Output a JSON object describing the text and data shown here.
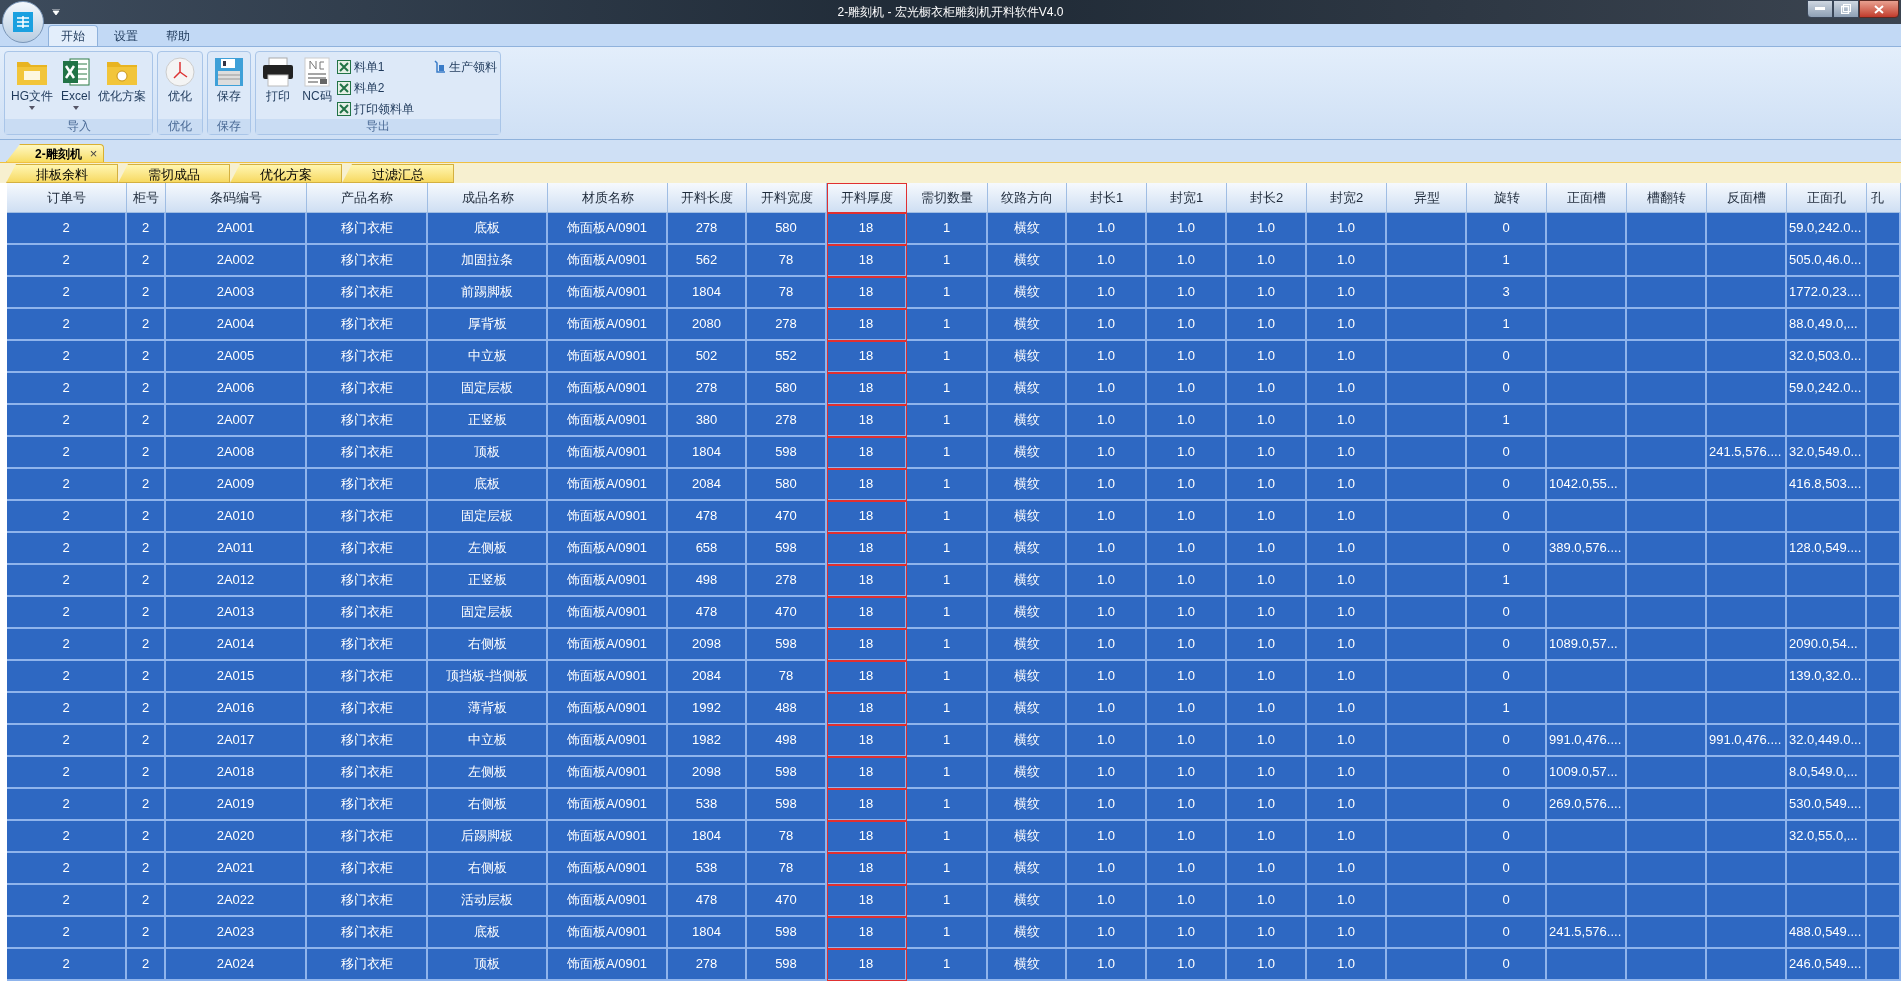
{
  "window": {
    "title": "2-雕刻机 - 宏光橱衣柜雕刻机开料软件V4.0"
  },
  "ribbon_tabs": [
    {
      "label": "开始",
      "selected": true
    },
    {
      "label": "设置",
      "selected": false
    },
    {
      "label": "帮助",
      "selected": false
    }
  ],
  "ribbon_groups": [
    {
      "label": "导入",
      "buttons": [
        {
          "label": "HG文件",
          "dropdown": true
        },
        {
          "label": "Excel",
          "dropdown": true
        },
        {
          "label": "优化方案",
          "dropdown": false
        }
      ]
    },
    {
      "label": "优化",
      "buttons": [
        {
          "label": "优化",
          "dropdown": false
        }
      ]
    },
    {
      "label": "保存",
      "buttons": [
        {
          "label": "保存",
          "dropdown": false
        }
      ]
    },
    {
      "label": "导出",
      "buttons": [
        {
          "label": "打印",
          "dropdown": false
        },
        {
          "label": "NC码",
          "dropdown": false
        }
      ],
      "small_buttons": [
        "料单1",
        "料单2",
        "打印领料单",
        "生产领料"
      ]
    }
  ],
  "document_tab": {
    "label": "2-雕刻机",
    "close": "×"
  },
  "sub_tabs": [
    "排板余料",
    "需切成品",
    "优化方案",
    "过滤汇总"
  ],
  "table": {
    "columns": [
      {
        "label": "订单号",
        "selected": false
      },
      {
        "label": "柜号",
        "selected": false
      },
      {
        "label": "条码编号",
        "selected": false
      },
      {
        "label": "产品名称",
        "selected": false
      },
      {
        "label": "成品名称",
        "selected": false
      },
      {
        "label": "材质名称",
        "selected": false
      },
      {
        "label": "开料长度",
        "selected": false
      },
      {
        "label": "开料宽度",
        "selected": false
      },
      {
        "label": "开料厚度",
        "selected": true
      },
      {
        "label": "需切数量",
        "selected": false
      },
      {
        "label": "纹路方向",
        "selected": false
      },
      {
        "label": "封长1",
        "selected": false
      },
      {
        "label": "封宽1",
        "selected": false
      },
      {
        "label": "封长2",
        "selected": false
      },
      {
        "label": "封宽2",
        "selected": false
      },
      {
        "label": "异型",
        "selected": false
      },
      {
        "label": "旋转",
        "selected": false
      },
      {
        "label": "正面槽",
        "selected": false
      },
      {
        "label": "槽翻转",
        "selected": false
      },
      {
        "label": "反面槽",
        "selected": false
      },
      {
        "label": "正面孔",
        "selected": false
      },
      {
        "label": "孔",
        "selected": false
      }
    ],
    "rows": [
      {
        "selected": true,
        "cells": [
          "2",
          "2",
          "2A001",
          "移门衣柜",
          "底板",
          "饰面板A/0901",
          "278",
          "580",
          "18",
          "1",
          "横纹",
          "1.0",
          "1.0",
          "1.0",
          "1.0",
          null,
          "0",
          null,
          null,
          null,
          "59.0,242.0...",
          null
        ]
      },
      {
        "selected": true,
        "cells": [
          "2",
          "2",
          "2A002",
          "移门衣柜",
          "加固拉条",
          "饰面板A/0901",
          "562",
          "78",
          "18",
          "1",
          "横纹",
          "1.0",
          "1.0",
          "1.0",
          "1.0",
          null,
          "1",
          null,
          null,
          null,
          "505.0,46.0...",
          null
        ]
      },
      {
        "selected": true,
        "cells": [
          "2",
          "2",
          "2A003",
          "移门衣柜",
          "前踢脚板",
          "饰面板A/0901",
          "1804",
          "78",
          "18",
          "1",
          "横纹",
          "1.0",
          "1.0",
          "1.0",
          "1.0",
          null,
          "3",
          null,
          null,
          null,
          "1772.0,23....",
          null
        ]
      },
      {
        "selected": true,
        "cells": [
          "2",
          "2",
          "2A004",
          "移门衣柜",
          "厚背板",
          "饰面板A/0901",
          "2080",
          "278",
          "18",
          "1",
          "横纹",
          "1.0",
          "1.0",
          "1.0",
          "1.0",
          null,
          "1",
          null,
          null,
          null,
          "88.0,49.0,...",
          null
        ]
      },
      {
        "selected": true,
        "cells": [
          "2",
          "2",
          "2A005",
          "移门衣柜",
          "中立板",
          "饰面板A/0901",
          "502",
          "552",
          "18",
          "1",
          "横纹",
          "1.0",
          "1.0",
          "1.0",
          "1.0",
          null,
          "0",
          null,
          null,
          null,
          "32.0,503.0...",
          null
        ]
      },
      {
        "selected": true,
        "cells": [
          "2",
          "2",
          "2A006",
          "移门衣柜",
          "固定层板",
          "饰面板A/0901",
          "278",
          "580",
          "18",
          "1",
          "横纹",
          "1.0",
          "1.0",
          "1.0",
          "1.0",
          null,
          "0",
          null,
          null,
          null,
          "59.0,242.0...",
          null
        ]
      },
      {
        "selected": true,
        "cells": [
          "2",
          "2",
          "2A007",
          "移门衣柜",
          "正竖板",
          "饰面板A/0901",
          "380",
          "278",
          "18",
          "1",
          "横纹",
          "1.0",
          "1.0",
          "1.0",
          "1.0",
          null,
          "1",
          null,
          null,
          null,
          null,
          null
        ]
      },
      {
        "selected": true,
        "cells": [
          "2",
          "2",
          "2A008",
          "移门衣柜",
          "顶板",
          "饰面板A/0901",
          "1804",
          "598",
          "18",
          "1",
          "横纹",
          "1.0",
          "1.0",
          "1.0",
          "1.0",
          null,
          "0",
          null,
          null,
          "241.5,576....",
          "32.0,549.0...",
          null
        ]
      },
      {
        "selected": true,
        "cells": [
          "2",
          "2",
          "2A009",
          "移门衣柜",
          "底板",
          "饰面板A/0901",
          "2084",
          "580",
          "18",
          "1",
          "横纹",
          "1.0",
          "1.0",
          "1.0",
          "1.0",
          null,
          "0",
          "1042.0,55...",
          null,
          null,
          "416.8,503....",
          null
        ]
      },
      {
        "selected": true,
        "cells": [
          "2",
          "2",
          "2A010",
          "移门衣柜",
          "固定层板",
          "饰面板A/0901",
          "478",
          "470",
          "18",
          "1",
          "横纹",
          "1.0",
          "1.0",
          "1.0",
          "1.0",
          null,
          "0",
          null,
          null,
          null,
          null,
          null
        ]
      },
      {
        "selected": true,
        "cells": [
          "2",
          "2",
          "2A011",
          "移门衣柜",
          "左侧板",
          "饰面板A/0901",
          "658",
          "598",
          "18",
          "1",
          "横纹",
          "1.0",
          "1.0",
          "1.0",
          "1.0",
          null,
          "0",
          "389.0,576....",
          null,
          null,
          "128.0,549....",
          null
        ]
      },
      {
        "selected": true,
        "cells": [
          "2",
          "2",
          "2A012",
          "移门衣柜",
          "正竖板",
          "饰面板A/0901",
          "498",
          "278",
          "18",
          "1",
          "横纹",
          "1.0",
          "1.0",
          "1.0",
          "1.0",
          null,
          "1",
          null,
          null,
          null,
          null,
          null
        ]
      },
      {
        "selected": true,
        "cells": [
          "2",
          "2",
          "2A013",
          "移门衣柜",
          "固定层板",
          "饰面板A/0901",
          "478",
          "470",
          "18",
          "1",
          "横纹",
          "1.0",
          "1.0",
          "1.0",
          "1.0",
          null,
          "0",
          null,
          null,
          null,
          null,
          null
        ]
      },
      {
        "selected": true,
        "cells": [
          "2",
          "2",
          "2A014",
          "移门衣柜",
          "右侧板",
          "饰面板A/0901",
          "2098",
          "598",
          "18",
          "1",
          "横纹",
          "1.0",
          "1.0",
          "1.0",
          "1.0",
          null,
          "0",
          "1089.0,57...",
          null,
          null,
          "2090.0,54...",
          null
        ]
      },
      {
        "selected": true,
        "cells": [
          "2",
          "2",
          "2A015",
          "移门衣柜",
          "顶挡板-挡侧板",
          "饰面板A/0901",
          "2084",
          "78",
          "18",
          "1",
          "横纹",
          "1.0",
          "1.0",
          "1.0",
          "1.0",
          null,
          "0",
          null,
          null,
          null,
          "139.0,32.0...",
          null
        ]
      },
      {
        "selected": true,
        "cells": [
          "2",
          "2",
          "2A016",
          "移门衣柜",
          "薄背板",
          "饰面板A/0901",
          "1992",
          "488",
          "18",
          "1",
          "横纹",
          "1.0",
          "1.0",
          "1.0",
          "1.0",
          null,
          "1",
          null,
          null,
          null,
          null,
          null
        ]
      },
      {
        "selected": true,
        "cells": [
          "2",
          "2",
          "2A017",
          "移门衣柜",
          "中立板",
          "饰面板A/0901",
          "1982",
          "498",
          "18",
          "1",
          "横纹",
          "1.0",
          "1.0",
          "1.0",
          "1.0",
          null,
          "0",
          "991.0,476....",
          null,
          "991.0,476....",
          "32.0,449.0...",
          null
        ]
      },
      {
        "selected": true,
        "cells": [
          "2",
          "2",
          "2A018",
          "移门衣柜",
          "左侧板",
          "饰面板A/0901",
          "2098",
          "598",
          "18",
          "1",
          "横纹",
          "1.0",
          "1.0",
          "1.0",
          "1.0",
          null,
          "0",
          "1009.0,57...",
          null,
          null,
          "8.0,549.0,...",
          null
        ]
      },
      {
        "selected": true,
        "cells": [
          "2",
          "2",
          "2A019",
          "移门衣柜",
          "右侧板",
          "饰面板A/0901",
          "538",
          "598",
          "18",
          "1",
          "横纹",
          "1.0",
          "1.0",
          "1.0",
          "1.0",
          null,
          "0",
          "269.0,576....",
          null,
          null,
          "530.0,549....",
          null
        ]
      },
      {
        "selected": true,
        "cells": [
          "2",
          "2",
          "2A020",
          "移门衣柜",
          "后踢脚板",
          "饰面板A/0901",
          "1804",
          "78",
          "18",
          "1",
          "横纹",
          "1.0",
          "1.0",
          "1.0",
          "1.0",
          null,
          "0",
          null,
          null,
          null,
          "32.0,55.0,...",
          null
        ]
      },
      {
        "selected": true,
        "cells": [
          "2",
          "2",
          "2A021",
          "移门衣柜",
          "右侧板",
          "饰面板A/0901",
          "538",
          "78",
          "18",
          "1",
          "横纹",
          "1.0",
          "1.0",
          "1.0",
          "1.0",
          null,
          "0",
          null,
          null,
          null,
          null,
          null
        ]
      },
      {
        "selected": true,
        "cells": [
          "2",
          "2",
          "2A022",
          "移门衣柜",
          "活动层板",
          "饰面板A/0901",
          "478",
          "470",
          "18",
          "1",
          "横纹",
          "1.0",
          "1.0",
          "1.0",
          "1.0",
          null,
          "0",
          null,
          null,
          null,
          null,
          null
        ]
      },
      {
        "selected": true,
        "cells": [
          "2",
          "2",
          "2A023",
          "移门衣柜",
          "底板",
          "饰面板A/0901",
          "1804",
          "598",
          "18",
          "1",
          "横纹",
          "1.0",
          "1.0",
          "1.0",
          "1.0",
          null,
          "0",
          "241.5,576....",
          null,
          null,
          "488.0,549....",
          null
        ]
      },
      {
        "selected": true,
        "cells": [
          "2",
          "2",
          "2A024",
          "移门衣柜",
          "顶板",
          "饰面板A/0901",
          "278",
          "598",
          "18",
          "1",
          "横纹",
          "1.0",
          "1.0",
          "1.0",
          "1.0",
          null,
          "0",
          null,
          null,
          null,
          "246.0,549....",
          null
        ]
      }
    ]
  }
}
